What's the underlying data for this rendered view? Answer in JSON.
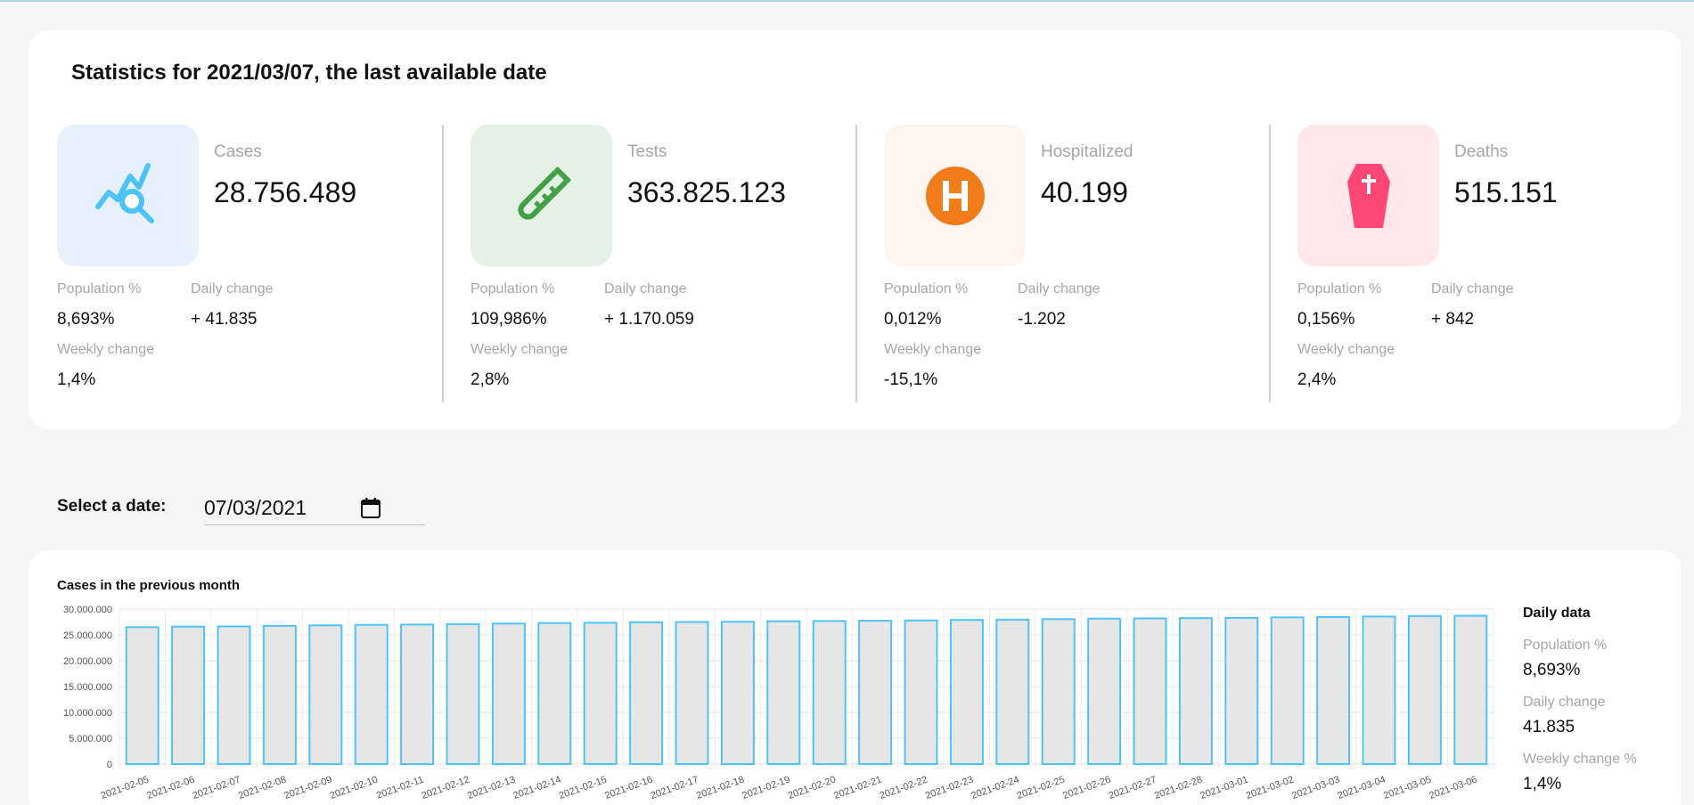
{
  "header": {
    "title": "Statistics for 2021/03/07, the last available date"
  },
  "stats": [
    {
      "label": "Cases",
      "value": "28.756.489",
      "icon": "trend-search-icon",
      "pop_label": "Population %",
      "pop_value": "8,693%",
      "daily_label": "Daily change",
      "daily_value": "+ 41.835",
      "weekly_label": "Weekly change",
      "weekly_value": "1,4%",
      "box_color": "#e6f1fd",
      "icon_color": "#4fc3f7"
    },
    {
      "label": "Tests",
      "value": "363.825.123",
      "icon": "test-tube-icon",
      "pop_label": "Population %",
      "pop_value": "109,986%",
      "daily_label": "Daily change",
      "daily_value": "+ 1.170.059",
      "weekly_label": "Weekly change",
      "weekly_value": "2,8%",
      "box_color": "#e3f2e4",
      "icon_color": "#43a047"
    },
    {
      "label": "Hospitalized",
      "value": "40.199",
      "icon": "hospital-icon",
      "pop_label": "Population %",
      "pop_value": "0,012%",
      "daily_label": "Daily change",
      "daily_value": "-1.202",
      "weekly_label": "Weekly change",
      "weekly_value": "-15,1%",
      "box_color": "#fff5ee",
      "icon_color": "#f07c1b"
    },
    {
      "label": "Deaths",
      "value": "515.151",
      "icon": "coffin-icon",
      "pop_label": "Population %",
      "pop_value": "0,156%",
      "daily_label": "Daily change",
      "daily_value": "+ 842",
      "weekly_label": "Weekly change",
      "weekly_value": "2,4%",
      "box_color": "#ffe7ea",
      "icon_color": "#ff4775"
    }
  ],
  "date_picker": {
    "label": "Select a date:",
    "value": "07/03/2021"
  },
  "chart_section": {
    "title": "Cases in the previous month",
    "daily_panel": {
      "title": "Daily data",
      "pop_label": "Population %",
      "pop_value": "8,693%",
      "daily_label": "Daily change",
      "daily_value": "41.835",
      "weekly_label": "Weekly change %",
      "weekly_value": "1,4%"
    }
  },
  "chart_data": {
    "type": "bar",
    "title": "Cases in the previous month",
    "xlabel": "",
    "ylabel": "",
    "ylim": [
      0,
      30000000
    ],
    "yticks": [
      "0",
      "5.000.000",
      "10.000.000",
      "15.000.000",
      "20.000.000",
      "25.000.000",
      "30.000.000"
    ],
    "grid": true,
    "bar_color": "#e6e6e6",
    "bar_edge_color": "#4fc3f7",
    "categories": [
      "2021-02-05",
      "2021-02-06",
      "2021-02-07",
      "2021-02-08",
      "2021-02-09",
      "2021-02-10",
      "2021-02-11",
      "2021-02-12",
      "2021-02-13",
      "2021-02-14",
      "2021-02-15",
      "2021-02-16",
      "2021-02-17",
      "2021-02-18",
      "2021-02-19",
      "2021-02-20",
      "2021-02-21",
      "2021-02-22",
      "2021-02-23",
      "2021-02-24",
      "2021-02-25",
      "2021-02-26",
      "2021-02-27",
      "2021-02-28",
      "2021-03-01",
      "2021-03-02",
      "2021-03-03",
      "2021-03-04",
      "2021-03-05",
      "2021-03-06"
    ],
    "values": [
      26500000,
      26600000,
      26650000,
      26750000,
      26850000,
      26950000,
      27000000,
      27100000,
      27200000,
      27300000,
      27350000,
      27450000,
      27500000,
      27550000,
      27650000,
      27700000,
      27750000,
      27800000,
      27900000,
      27950000,
      28050000,
      28150000,
      28200000,
      28250000,
      28300000,
      28400000,
      28450000,
      28550000,
      28650000,
      28700000
    ]
  }
}
